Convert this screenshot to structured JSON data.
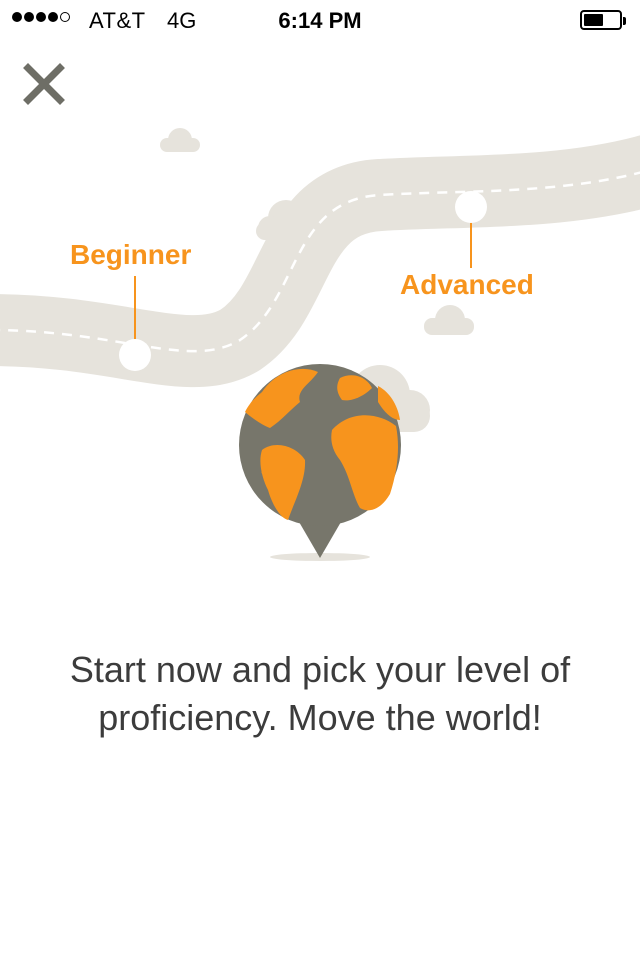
{
  "status_bar": {
    "signal_bars_filled": 4,
    "signal_bars_total": 5,
    "carrier": "AT&T",
    "network": "4G",
    "time": "6:14 PM",
    "battery_level": 0.55
  },
  "close_icon": "close-icon",
  "levels": {
    "beginner": "Beginner",
    "advanced": "Advanced"
  },
  "caption": "Start now and pick your level of proficiency. Move the world!",
  "colors": {
    "accent": "#f7941d",
    "road": "#e6e3dc",
    "cloud": "#e6e3dc",
    "globe": "#77766b",
    "text": "#3c3c3c"
  }
}
